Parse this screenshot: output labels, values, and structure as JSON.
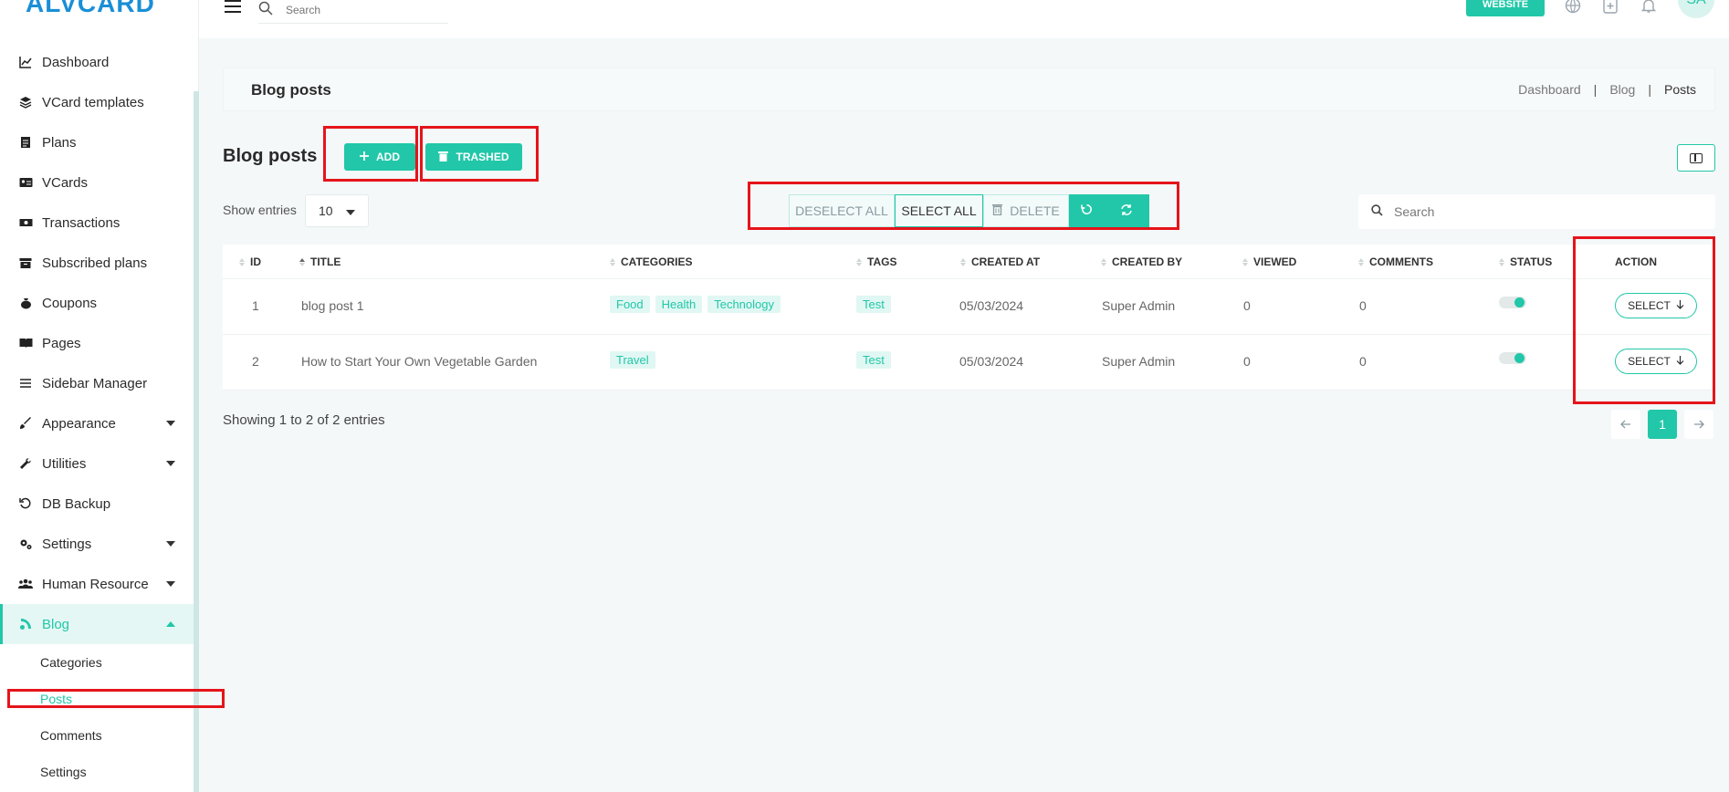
{
  "app": {
    "logo": "ALVCARD"
  },
  "topbar": {
    "search_placeholder": "Search",
    "website_label": "WEBSITE",
    "avatar_initials": "SA"
  },
  "sidebar": {
    "items": [
      {
        "label": "Dashboard",
        "icon": "chart-line-icon"
      },
      {
        "label": "VCard templates",
        "icon": "layers-icon"
      },
      {
        "label": "Plans",
        "icon": "document-icon"
      },
      {
        "label": "VCards",
        "icon": "id-card-icon"
      },
      {
        "label": "Transactions",
        "icon": "money-icon"
      },
      {
        "label": "Subscribed plans",
        "icon": "archive-icon"
      },
      {
        "label": "Coupons",
        "icon": "bag-icon"
      },
      {
        "label": "Pages",
        "icon": "book-icon"
      },
      {
        "label": "Sidebar Manager",
        "icon": "list-icon"
      },
      {
        "label": "Appearance",
        "icon": "brush-icon"
      },
      {
        "label": "Utilities",
        "icon": "wrench-icon"
      },
      {
        "label": "DB Backup",
        "icon": "history-icon"
      },
      {
        "label": "Settings",
        "icon": "gears-icon"
      },
      {
        "label": "Human Resource",
        "icon": "users-icon"
      },
      {
        "label": "Blog",
        "icon": "blog-icon"
      }
    ],
    "blog_sub": [
      "Categories",
      "Posts",
      "Comments",
      "Settings"
    ]
  },
  "header": {
    "title": "Blog posts",
    "breadcrumb": [
      "Dashboard",
      "Blog",
      "Posts"
    ]
  },
  "section": {
    "title": "Blog posts",
    "add_label": "ADD",
    "trashed_label": "TRASHED"
  },
  "controls": {
    "show_entries_label": "Show entries",
    "entries_value": "10",
    "deselect_all": "DESELECT ALL",
    "select_all": "SELECT ALL",
    "delete": "DELETE",
    "search_placeholder": "Search"
  },
  "table": {
    "columns": [
      "ID",
      "TITLE",
      "CATEGORIES",
      "TAGS",
      "CREATED AT",
      "CREATED BY",
      "VIEWED",
      "COMMENTS",
      "STATUS",
      "ACTION"
    ],
    "rows": [
      {
        "id": "1",
        "title": "blog post 1",
        "categories": [
          "Food",
          "Health",
          "Technology"
        ],
        "tags": [
          "Test"
        ],
        "created_at": "05/03/2024",
        "created_by": "Super Admin",
        "viewed": "0",
        "comments": "0",
        "status_on": true,
        "action": "SELECT"
      },
      {
        "id": "2",
        "title": "How to Start Your Own Vegetable Garden",
        "categories": [
          "Travel"
        ],
        "tags": [
          "Test"
        ],
        "created_at": "05/03/2024",
        "created_by": "Super Admin",
        "viewed": "0",
        "comments": "0",
        "status_on": true,
        "action": "SELECT"
      }
    ]
  },
  "footer": {
    "showing": "Showing 1 to 2 of 2 entries",
    "current_page": "1"
  },
  "colors": {
    "accent": "#21c7a8",
    "highlight": "#e5141b"
  }
}
